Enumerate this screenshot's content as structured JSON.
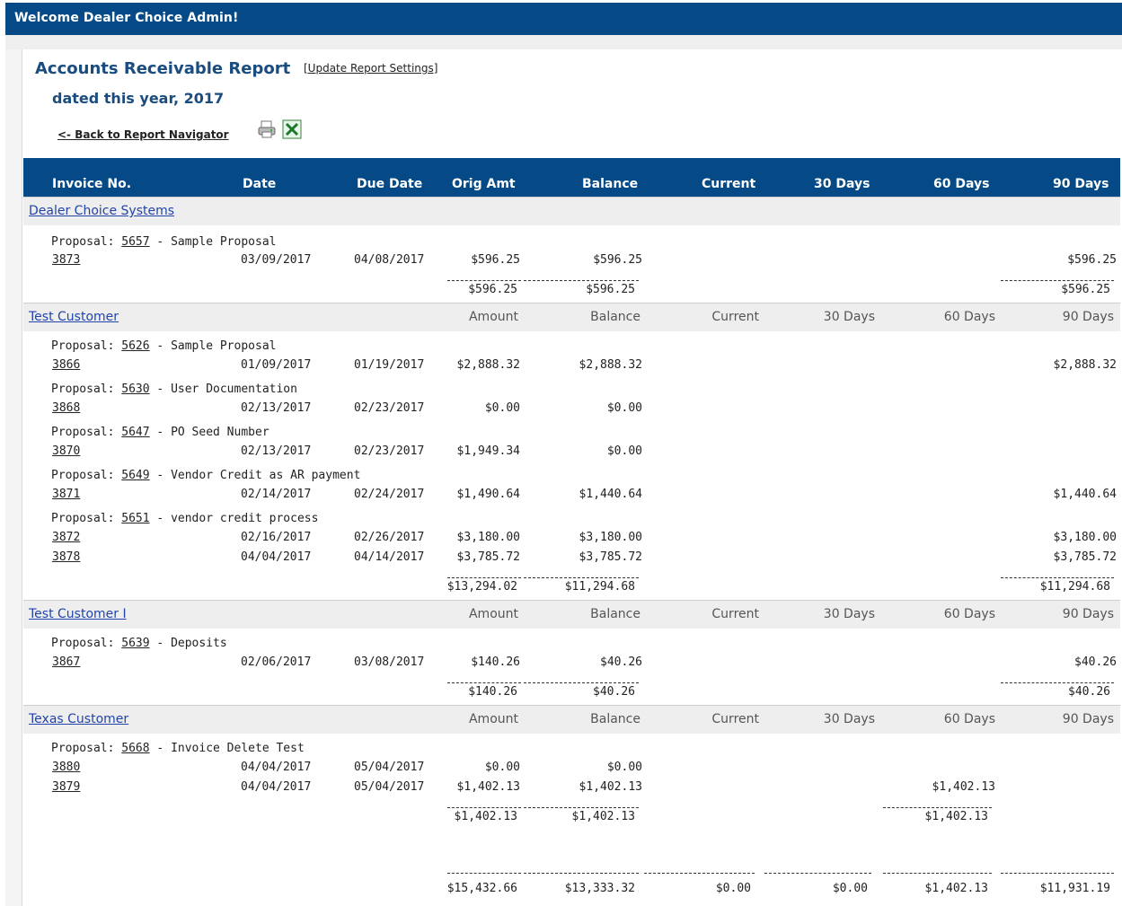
{
  "app": {
    "welcome": "Welcome Dealer Choice Admin!"
  },
  "report": {
    "title": "Accounts Receivable Report",
    "update_link": "[Update Report Settings]",
    "dated": "dated this year, 2017",
    "back_link": "<- Back to Report Navigator",
    "icons": [
      "print-icon",
      "excel-icon"
    ]
  },
  "columns": {
    "invoice": "Invoice No.",
    "date": "Date",
    "due": "Due Date",
    "orig": "Orig Amt",
    "balance": "Balance",
    "current": "Current",
    "d30": "30 Days",
    "d60": "60 Days",
    "d90": "90 Days"
  },
  "subheader": {
    "amount": "Amount",
    "balance": "Balance",
    "current": "Current",
    "d30": "30 Days",
    "d60": "60 Days",
    "d90": "90 Days"
  },
  "customers": [
    {
      "name": "Dealer Choice Systems",
      "proposals": [
        {
          "prefix": "Proposal: ",
          "number": "5657",
          "desc": " - Sample Proposal",
          "invoices": [
            {
              "no": "3873",
              "date": "03/09/2017",
              "due": "04/08/2017",
              "orig": "$596.25",
              "balance": "$596.25",
              "current": "",
              "d30": "",
              "d60": "",
              "d90": "$596.25"
            }
          ]
        }
      ],
      "totals": {
        "orig": "$596.25",
        "balance": "$596.25",
        "current": "",
        "d30": "",
        "d60": "",
        "d90": "$596.25"
      }
    },
    {
      "name": "Test Customer",
      "proposals": [
        {
          "prefix": "Proposal: ",
          "number": "5626",
          "desc": " - Sample Proposal",
          "invoices": [
            {
              "no": "3866",
              "date": "01/09/2017",
              "due": "01/19/2017",
              "orig": "$2,888.32",
              "balance": "$2,888.32",
              "current": "",
              "d30": "",
              "d60": "",
              "d90": "$2,888.32"
            }
          ]
        },
        {
          "prefix": "Proposal: ",
          "number": "5630",
          "desc": " - User Documentation",
          "invoices": [
            {
              "no": "3868",
              "date": "02/13/2017",
              "due": "02/23/2017",
              "orig": "$0.00",
              "balance": "$0.00",
              "current": "",
              "d30": "",
              "d60": "",
              "d90": ""
            }
          ]
        },
        {
          "prefix": "Proposal: ",
          "number": "5647",
          "desc": " - PO Seed Number",
          "invoices": [
            {
              "no": "3870",
              "date": "02/13/2017",
              "due": "02/23/2017",
              "orig": "$1,949.34",
              "balance": "$0.00",
              "current": "",
              "d30": "",
              "d60": "",
              "d90": ""
            }
          ]
        },
        {
          "prefix": "Proposal: ",
          "number": "5649",
          "desc": " - Vendor Credit as AR payment",
          "invoices": [
            {
              "no": "3871",
              "date": "02/14/2017",
              "due": "02/24/2017",
              "orig": "$1,490.64",
              "balance": "$1,440.64",
              "current": "",
              "d30": "",
              "d60": "",
              "d90": "$1,440.64"
            }
          ]
        },
        {
          "prefix": "Proposal: ",
          "number": "5651",
          "desc": " - vendor credit process",
          "invoices": [
            {
              "no": "3872",
              "date": "02/16/2017",
              "due": "02/26/2017",
              "orig": "$3,180.00",
              "balance": "$3,180.00",
              "current": "",
              "d30": "",
              "d60": "",
              "d90": "$3,180.00"
            },
            {
              "no": "3878",
              "date": "04/04/2017",
              "due": "04/14/2017",
              "orig": "$3,785.72",
              "balance": "$3,785.72",
              "current": "",
              "d30": "",
              "d60": "",
              "d90": "$3,785.72"
            }
          ]
        }
      ],
      "totals": {
        "orig": "$13,294.02",
        "balance": "$11,294.68",
        "current": "",
        "d30": "",
        "d60": "",
        "d90": "$11,294.68"
      }
    },
    {
      "name": "Test Customer I",
      "proposals": [
        {
          "prefix": "Proposal: ",
          "number": "5639",
          "desc": " - Deposits",
          "invoices": [
            {
              "no": "3867",
              "date": "02/06/2017",
              "due": "03/08/2017",
              "orig": "$140.26",
              "balance": "$40.26",
              "current": "",
              "d30": "",
              "d60": "",
              "d90": "$40.26"
            }
          ]
        }
      ],
      "totals": {
        "orig": "$140.26",
        "balance": "$40.26",
        "current": "",
        "d30": "",
        "d60": "",
        "d90": "$40.26"
      }
    },
    {
      "name": "Texas Customer",
      "proposals": [
        {
          "prefix": "Proposal: ",
          "number": "5668",
          "desc": " - Invoice Delete Test",
          "invoices": [
            {
              "no": "3880",
              "date": "04/04/2017",
              "due": "05/04/2017",
              "orig": "$0.00",
              "balance": "$0.00",
              "current": "",
              "d30": "",
              "d60": "",
              "d90": ""
            },
            {
              "no": "3879",
              "date": "04/04/2017",
              "due": "05/04/2017",
              "orig": "$1,402.13",
              "balance": "$1,402.13",
              "current": "",
              "d30": "",
              "d60": "$1,402.13",
              "d90": ""
            }
          ]
        }
      ],
      "totals": {
        "orig": "$1,402.13",
        "balance": "$1,402.13",
        "current": "",
        "d30": "",
        "d60": "$1,402.13",
        "d90": ""
      }
    }
  ],
  "grand_totals": {
    "orig": "$15,432.66",
    "balance": "$13,333.32",
    "current": "$0.00",
    "d30": "$0.00",
    "d60": "$1,402.13",
    "d90": "$11,931.19"
  },
  "colors": {
    "header_blue": "#054a86",
    "title_blue": "#1a4c80",
    "link_blue": "#2244aa",
    "band_gray": "#eeeeee"
  }
}
